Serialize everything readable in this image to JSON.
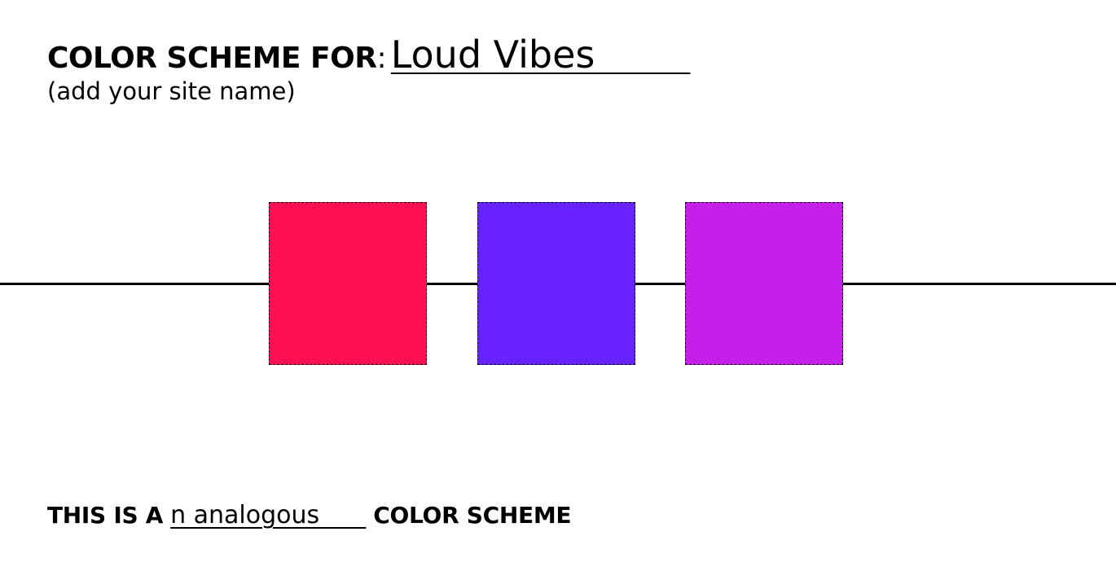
{
  "header": {
    "label": "COLOR SCHEME FOR",
    "colon": ":",
    "site_name": "Loud Vibes",
    "blank": "        "
  },
  "subtitle": "(add your site name)",
  "swatches": [
    {
      "color": "#ff1053"
    },
    {
      "color": "#6622ff"
    },
    {
      "color": "#c520ea"
    }
  ],
  "footer": {
    "prefix": "THIS IS A",
    "answer": "n analogous      ",
    "suffix": "COLOR SCHEME"
  }
}
